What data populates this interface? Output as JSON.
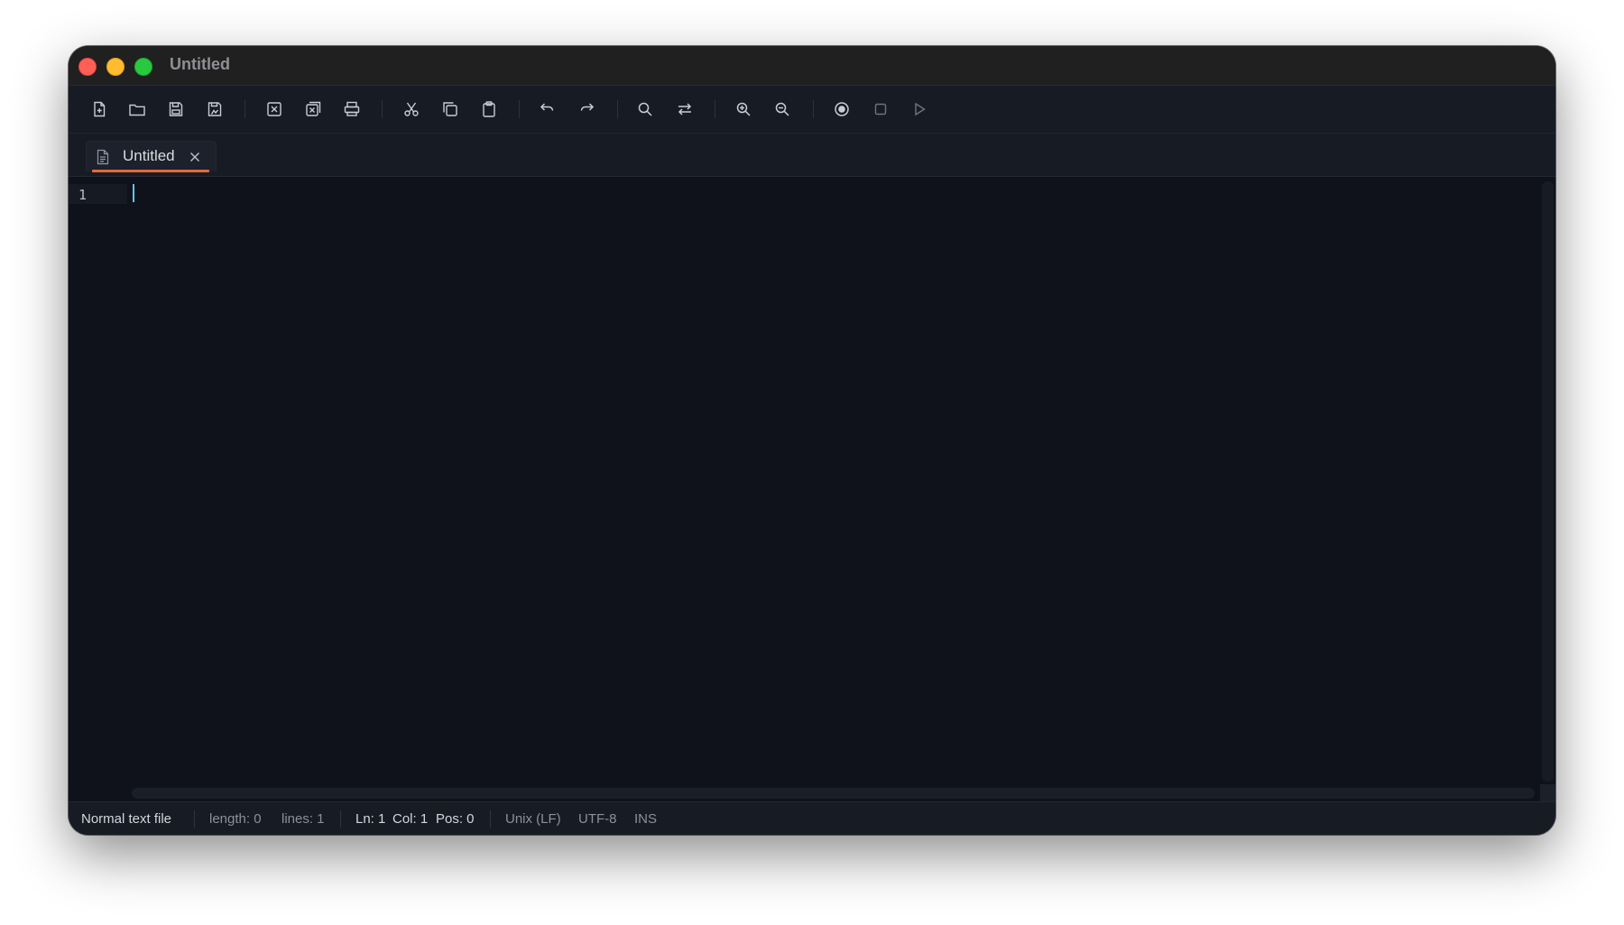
{
  "window": {
    "title": "Untitled"
  },
  "toolbar": {
    "buttons": [
      {
        "name": "new-file",
        "icon": "new-file-icon"
      },
      {
        "name": "open-file",
        "icon": "folder-icon"
      },
      {
        "name": "save",
        "icon": "save-icon"
      },
      {
        "name": "save-all",
        "icon": "save-all-icon"
      },
      {
        "name": "close-file",
        "icon": "close-file-icon"
      },
      {
        "name": "close-all",
        "icon": "close-all-icon"
      },
      {
        "name": "print",
        "icon": "print-icon"
      },
      {
        "name": "cut",
        "icon": "scissors-icon"
      },
      {
        "name": "copy",
        "icon": "copy-icon"
      },
      {
        "name": "paste",
        "icon": "clipboard-icon"
      },
      {
        "name": "undo",
        "icon": "undo-icon"
      },
      {
        "name": "redo",
        "icon": "redo-icon"
      },
      {
        "name": "find",
        "icon": "search-icon"
      },
      {
        "name": "replace",
        "icon": "replace-icon"
      },
      {
        "name": "zoom-in",
        "icon": "zoom-in-icon"
      },
      {
        "name": "zoom-out",
        "icon": "zoom-out-icon"
      },
      {
        "name": "record-macro",
        "icon": "record-icon"
      },
      {
        "name": "stop-macro",
        "icon": "stop-icon"
      },
      {
        "name": "play-macro",
        "icon": "play-icon"
      }
    ]
  },
  "tabs": [
    {
      "label": "Untitled",
      "icon": "document-icon",
      "active": true
    }
  ],
  "editor": {
    "line_numbers": [
      "1"
    ],
    "content": ""
  },
  "status": {
    "file_type": "Normal text file",
    "length": "length: 0",
    "lines": "lines: 1",
    "line": "Ln: 1",
    "column": "Col: 1",
    "position": "Pos: 0",
    "eol": "Unix (LF)",
    "encoding": "UTF-8",
    "mode": "INS"
  },
  "colors": {
    "accent": "#e8683b",
    "caret": "#5bc8f0",
    "editor_bg": "#0f121a",
    "chrome_bg": "#171b24",
    "close_light": "#fe5f57",
    "minimize_light": "#febc2e",
    "maximize_light": "#28c840"
  }
}
